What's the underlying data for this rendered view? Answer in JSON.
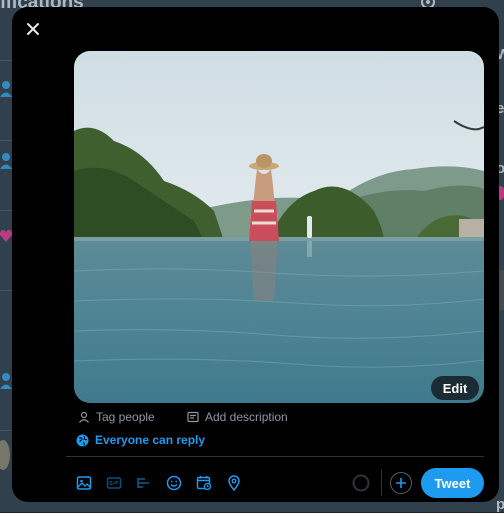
{
  "background": {
    "title": "tifications",
    "right_letters": [
      "W",
      "e",
      "o",
      "p"
    ]
  },
  "modal": {
    "close_icon": "close-icon",
    "edit_label": "Edit",
    "tag_people_label": "Tag people",
    "add_description_label": "Add description",
    "reply_setting_label": "Everyone can reply",
    "tweet_label": "Tweet",
    "toolbar_icons": [
      "media-icon",
      "gif-icon",
      "poll-icon",
      "emoji-icon",
      "schedule-icon",
      "location-icon"
    ]
  },
  "colors": {
    "accent": "#1d9bf0",
    "modal_bg": "#000000",
    "page_bg": "#15202b",
    "muted_text": "#8b98a5"
  }
}
